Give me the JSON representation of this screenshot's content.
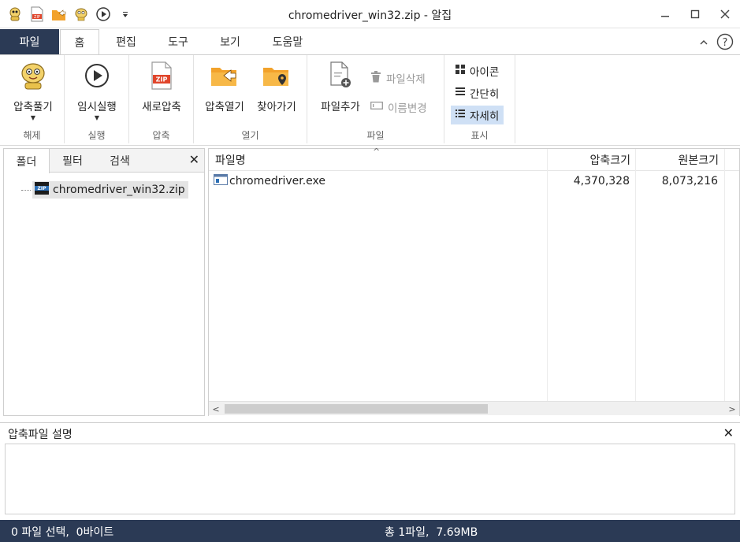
{
  "window": {
    "title": "chromedriver_win32.zip - 알집",
    "controls": {
      "minimize": "–",
      "maximize": "☐",
      "close": "✕"
    }
  },
  "quick_access": [
    "alzip-mascot-icon",
    "zip-file-icon",
    "open-folder-icon",
    "extract-icon",
    "play-icon",
    "dropdown-arrow-icon"
  ],
  "tabs": [
    {
      "label": "파일",
      "active": false
    },
    {
      "label": "홈",
      "active": true
    },
    {
      "label": "편집",
      "active": false
    },
    {
      "label": "도구",
      "active": false
    },
    {
      "label": "보기",
      "active": false
    },
    {
      "label": "도움말",
      "active": false
    }
  ],
  "ribbon": {
    "extract": {
      "button": "압축풀기",
      "group": "해제"
    },
    "run": {
      "button": "임시실행",
      "group": "실행"
    },
    "compress": {
      "button": "새로압축",
      "group": "압축"
    },
    "open": {
      "open_button": "압축열기",
      "find_button": "찾아가기",
      "group": "열기"
    },
    "file": {
      "add_button": "파일추가",
      "delete_button": "파일삭제",
      "rename_button": "이름변경",
      "group": "파일"
    },
    "view": {
      "icons": "아이콘",
      "simple": "간단히",
      "detail": "자세히",
      "group": "표시",
      "selected": "자세히"
    }
  },
  "left_panel": {
    "tabs": [
      "폴더",
      "필터",
      "검색"
    ],
    "active_tab": "폴더",
    "close": "✕",
    "tree": [
      {
        "label": "chromedriver_win32.zip",
        "icon": "zip-icon"
      }
    ]
  },
  "file_list": {
    "columns": [
      "파일명",
      "압축크기",
      "원본크기"
    ],
    "sort_indicator": "^",
    "rows": [
      {
        "name": "chromedriver.exe",
        "compressed": "4,370,328",
        "original": "8,073,216",
        "icon": "exe-icon"
      }
    ],
    "scroll_left": "<",
    "scroll_right": ">"
  },
  "description": {
    "label": "압축파일 설명",
    "close": "✕",
    "text": ""
  },
  "status": {
    "left": "0 파일 선택,  0바이트",
    "center": "총 1파일,  7.69MB"
  },
  "colors": {
    "accent_dark": "#2b3a55",
    "selected": "#cfe0f5",
    "zip_red": "#e0452b",
    "folder_orange": "#f2a22b"
  }
}
